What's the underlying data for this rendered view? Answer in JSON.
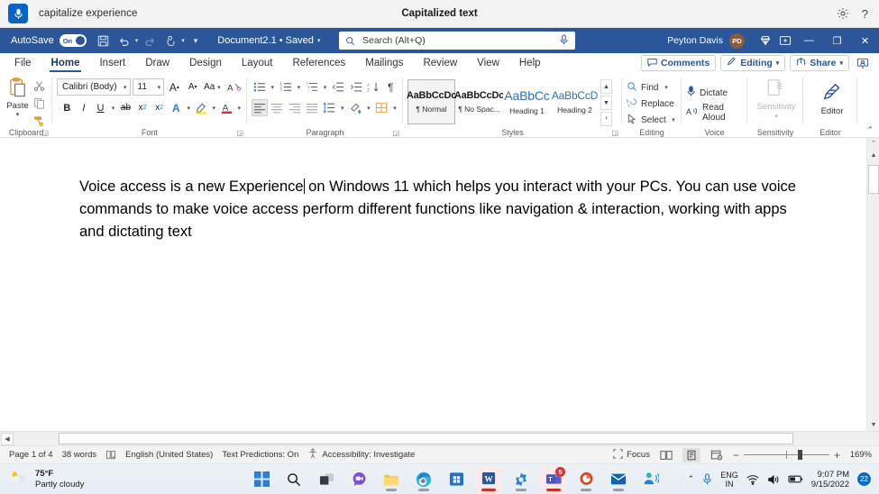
{
  "voice_access": {
    "mic_icon": "microphone-icon",
    "command_text": "capitalize experience",
    "title": "Capitalized text",
    "settings_icon": "gear-icon",
    "help_icon": "help-icon"
  },
  "titlebar": {
    "autosave_label": "AutoSave",
    "autosave_state": "On",
    "quick_access": [
      {
        "name": "save-button",
        "icon": "save-icon"
      },
      {
        "name": "undo-button",
        "icon": "undo-icon"
      },
      {
        "name": "redo-button",
        "icon": "redo-icon"
      },
      {
        "name": "touch-mode-button",
        "icon": "touch-pointer-icon"
      },
      {
        "name": "customize-quick-access-button",
        "icon": "chevron-down-icon"
      }
    ],
    "document_name": "Document2.1 • Saved",
    "search": {
      "placeholder": "Search (Alt+Q)",
      "search_icon": "search-icon",
      "dictate_icon": "microphone-icon"
    },
    "user_name": "Peyton Davis",
    "user_initials": "PD",
    "diamond_icon": "premium-diamond-icon",
    "ribbon_display_icon": "ribbon-display-options-icon",
    "minimize": "—",
    "restore": "❐",
    "close": "✕"
  },
  "ribbon_tabs": [
    {
      "label": "File",
      "active": false
    },
    {
      "label": "Home",
      "active": true
    },
    {
      "label": "Insert",
      "active": false
    },
    {
      "label": "Draw",
      "active": false
    },
    {
      "label": "Design",
      "active": false
    },
    {
      "label": "Layout",
      "active": false
    },
    {
      "label": "References",
      "active": false
    },
    {
      "label": "Mailings",
      "active": false
    },
    {
      "label": "Review",
      "active": false
    },
    {
      "label": "View",
      "active": false
    },
    {
      "label": "Help",
      "active": false
    }
  ],
  "ribbon_right": {
    "comments": "Comments",
    "comments_icon": "comment-icon",
    "editing": "Editing",
    "editing_icon": "pencil-icon",
    "share": "Share",
    "share_icon": "share-icon",
    "present_icon": "present-person-icon"
  },
  "ribbon": {
    "clipboard": {
      "label": "Clipboard",
      "paste_label": "Paste",
      "paste_icon": "clipboard-paste-icon",
      "cut_icon": "scissors-icon",
      "copy_icon": "copy-icon",
      "format_painter_icon": "format-painter-icon",
      "dialog_icon": "dialog-launcher-icon"
    },
    "font": {
      "label": "Font",
      "font_name": "Calibri (Body)",
      "font_size": "11",
      "grow_font_icon": "grow-font-icon",
      "shrink_font_icon": "shrink-font-icon",
      "change_case_icon": "change-case-icon",
      "clear_formatting_icon": "clear-formatting-icon",
      "bold": "B",
      "italic": "I",
      "underline": "U",
      "strikethrough_icon": "strikethrough-icon",
      "subscript_icon": "subscript-icon",
      "superscript_icon": "superscript-icon",
      "text_effects_icon": "text-effects-icon",
      "highlight_icon": "text-highlight-icon",
      "font_color_icon": "font-color-icon",
      "dialog_icon": "dialog-launcher-icon"
    },
    "paragraph": {
      "label": "Paragraph",
      "bullets_icon": "bullet-list-icon",
      "numbering_icon": "numbered-list-icon",
      "multilevel_icon": "multilevel-list-icon",
      "decrease_indent_icon": "decrease-indent-icon",
      "increase_indent_icon": "increase-indent-icon",
      "sort_icon": "sort-az-icon",
      "show_marks_icon": "paragraph-mark-icon",
      "align_left_icon": "align-left-icon",
      "align_center_icon": "align-center-icon",
      "align_right_icon": "align-right-icon",
      "justify_icon": "justify-icon",
      "line_spacing_icon": "line-spacing-icon",
      "shading_icon": "shading-icon",
      "borders_icon": "borders-icon",
      "dialog_icon": "dialog-launcher-icon"
    },
    "styles": {
      "label": "Styles",
      "items": [
        {
          "sample": "AaBbCcDc",
          "name": "¶ Normal",
          "selected": true,
          "kind": "normal"
        },
        {
          "sample": "AaBbCcDc",
          "name": "¶ No Spac...",
          "selected": false,
          "kind": "normal"
        },
        {
          "sample": "AaBbCc",
          "name": "Heading 1",
          "selected": false,
          "kind": "h1"
        },
        {
          "sample": "AaBbCcD",
          "name": "Heading 2",
          "selected": false,
          "kind": "h2"
        }
      ],
      "scroll_up_icon": "chevron-up-icon",
      "scroll_down_icon": "chevron-down-icon",
      "more_icon": "more-styles-icon",
      "dialog_icon": "dialog-launcher-icon"
    },
    "editing": {
      "label": "Editing",
      "find": "Find",
      "find_icon": "search-icon",
      "replace": "Replace",
      "replace_icon": "replace-icon",
      "select": "Select",
      "select_icon": "select-cursor-icon"
    },
    "voice": {
      "label": "Voice",
      "dictate": "Dictate",
      "dictate_icon": "microphone-icon",
      "read_aloud": "Read Aloud",
      "read_aloud_icon": "read-aloud-icon"
    },
    "sensitivity": {
      "label": "Sensitivity",
      "button_label": "Sensitivity",
      "icon": "sensitivity-icon"
    },
    "editor": {
      "label": "Editor",
      "button_label": "Editor",
      "icon": "editor-pen-icon"
    },
    "collapse_icon": "chevron-up-icon"
  },
  "document": {
    "text_before_caret": "Voice access is a new Experience",
    "text_after_caret": " on Windows 11 which helps you interact with your PCs. You can use voice commands to make voice access perform different functions like navigation & interaction, working with apps and dictating text"
  },
  "scrollbars": {
    "v_up_icon": "chevron-up-icon",
    "v_down_icon": "chevron-down-icon",
    "v_split_icon": "split-window-icon",
    "h_left_icon": "chevron-left-icon",
    "h_right_icon": "chevron-right-icon"
  },
  "status_bar": {
    "page": "Page 1 of 4",
    "words": "38 words",
    "proofing_icon": "proofing-icon",
    "language": "English (United States)",
    "text_predictions": "Text Predictions: On",
    "accessibility_icon": "accessibility-icon",
    "accessibility": "Accessibility: Investigate",
    "focus": "Focus",
    "focus_icon": "focus-icon",
    "read_mode_icon": "read-mode-icon",
    "print_layout_icon": "print-layout-icon",
    "web_layout_icon": "web-layout-icon",
    "zoom_out": "−",
    "zoom_in": "+",
    "zoom_level": "169%"
  },
  "taskbar": {
    "weather_temp": "75°F",
    "weather_desc": "Partly cloudy",
    "weather_icon": "partly-cloudy-icon",
    "items": [
      {
        "name": "start-button",
        "icon": "windows-start-icon",
        "active": false,
        "running": false,
        "badge": ""
      },
      {
        "name": "search-button",
        "icon": "search-icon",
        "active": false,
        "running": false,
        "badge": ""
      },
      {
        "name": "task-view-button",
        "icon": "task-view-icon",
        "active": false,
        "running": false,
        "badge": ""
      },
      {
        "name": "chat-button",
        "icon": "chat-icon",
        "active": false,
        "running": false,
        "badge": ""
      },
      {
        "name": "file-explorer-button",
        "icon": "file-explorer-icon",
        "active": false,
        "running": true,
        "badge": ""
      },
      {
        "name": "edge-button",
        "icon": "edge-icon",
        "active": false,
        "running": true,
        "badge": ""
      },
      {
        "name": "microsoft-store-button",
        "icon": "store-icon",
        "active": false,
        "running": false,
        "badge": ""
      },
      {
        "name": "word-button",
        "icon": "word-icon",
        "active": true,
        "running": true,
        "badge": ""
      },
      {
        "name": "settings-button",
        "icon": "settings-gear-icon",
        "active": false,
        "running": true,
        "badge": ""
      },
      {
        "name": "teams-button",
        "icon": "teams-icon",
        "active": true,
        "running": true,
        "badge": "5"
      },
      {
        "name": "powerpoint-button",
        "icon": "powerpoint-icon",
        "active": false,
        "running": true,
        "badge": ""
      },
      {
        "name": "mail-button",
        "icon": "mail-icon",
        "active": false,
        "running": true,
        "badge": ""
      },
      {
        "name": "voice-access-button",
        "icon": "voice-access-icon",
        "active": false,
        "running": false,
        "badge": ""
      }
    ],
    "tray": {
      "show_hidden_icon": "chevron-up-icon",
      "mic_icon": "microphone-icon",
      "language_line1": "ENG",
      "language_line2": "IN",
      "wifi_icon": "wifi-icon",
      "volume_icon": "volume-icon",
      "battery_icon": "battery-icon",
      "time": "9:07 PM",
      "date": "9/15/2022",
      "notification_count": "22"
    }
  }
}
